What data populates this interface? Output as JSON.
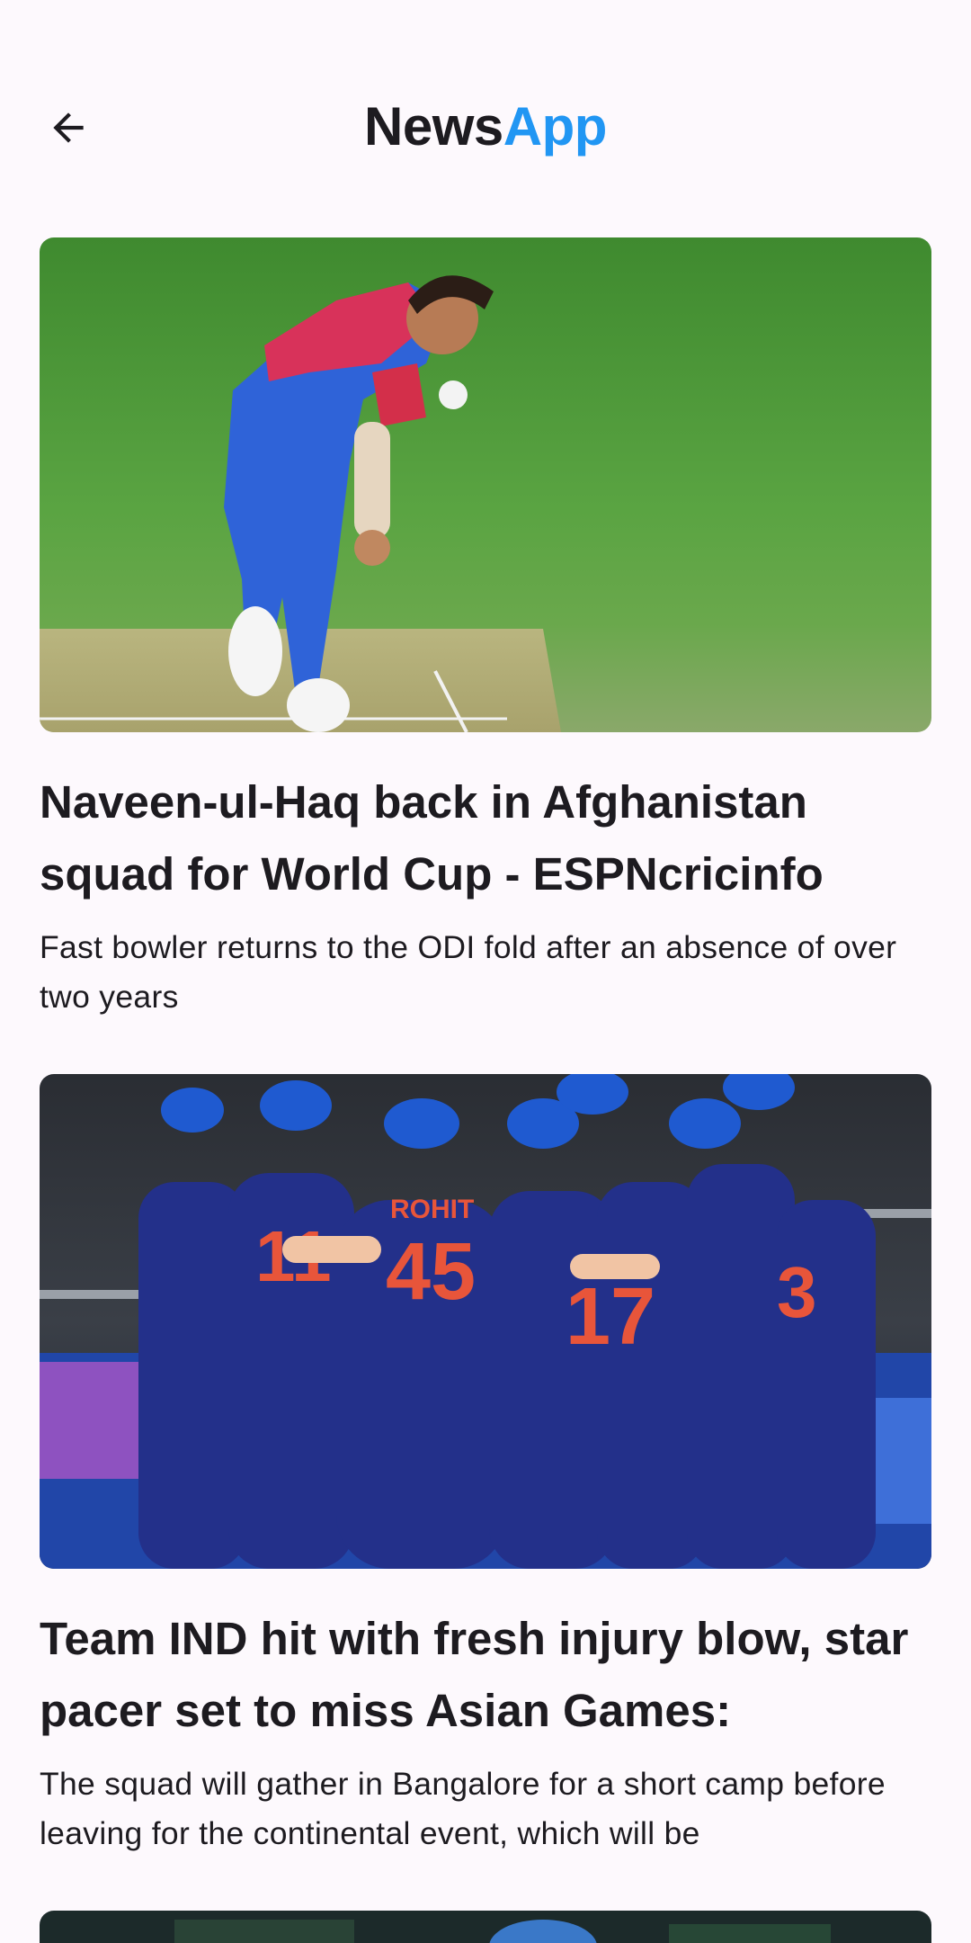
{
  "app_bar": {
    "title_part1": "News",
    "title_part2": "App",
    "title_part2_color": "#2196f3",
    "back_icon": "arrow-back-icon"
  },
  "articles": [
    {
      "image": "cricket-bowler-photo",
      "title": "Naveen-ul-Haq back in Afghanistan squad for World Cup - ESPNcricinfo",
      "description": "Fast bowler returns to the ODI fold after an absence of over two years"
    },
    {
      "image": "cricket-team-huddle-photo",
      "title": "Team IND hit with fresh injury blow, star pacer set to miss Asian Games:",
      "description": "The squad will gather in Bangalore for a short camp before leaving for the continental event, which will be"
    },
    {
      "image": "cricket-match-photo"
    }
  ]
}
